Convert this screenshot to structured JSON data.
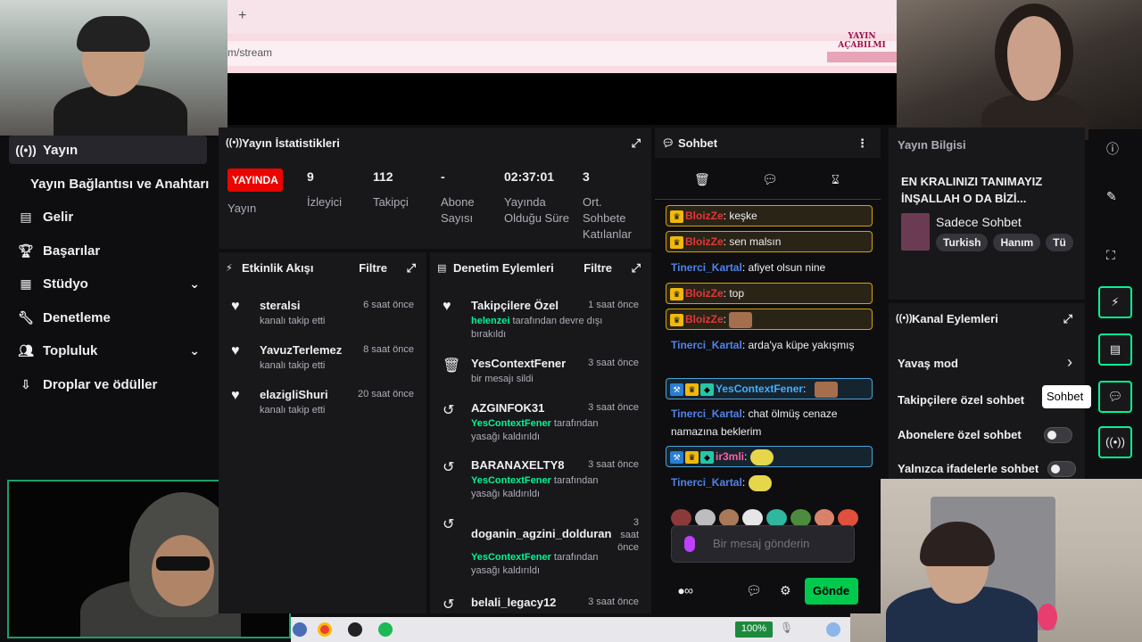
{
  "browser": {
    "url_partial": "m/stream",
    "new_tab": "+",
    "banner_text": "YAYIN AÇABILMI"
  },
  "nav": {
    "items": [
      {
        "label": "Yayın",
        "icon": "broadcast-icon"
      },
      {
        "label": "Yayın Bağlantısı ve Anahtarı",
        "icon": ""
      },
      {
        "label": "Gelir",
        "icon": "revenue-icon"
      },
      {
        "label": "Başarılar",
        "icon": "trophy-icon"
      },
      {
        "label": "Stüdyo",
        "icon": "studio-icon"
      },
      {
        "label": "Denetleme",
        "icon": "wrench-icon"
      },
      {
        "label": "Topluluk",
        "icon": "community-icon"
      },
      {
        "label": "Droplar ve ödüller",
        "icon": "drops-icon"
      }
    ]
  },
  "stats": {
    "title": "Yayın İstatistikleri",
    "live_badge": "YAYINDA",
    "cols": [
      {
        "value": "",
        "label": "Yayın"
      },
      {
        "value": "9",
        "label": "İzleyici"
      },
      {
        "value": "112",
        "label": "Takipçi"
      },
      {
        "value": "-",
        "label": "Abone Sayısı"
      },
      {
        "value": "02:37:01",
        "label": "Yayında Olduğu Süre"
      },
      {
        "value": "3",
        "label": "Ort. Sohbete Katılanlar"
      }
    ]
  },
  "activity": {
    "title": "Etkinlik Akışı",
    "filter": "Filtre",
    "items": [
      {
        "user": "steralsi",
        "time": "6 saat önce",
        "desc": "kanalı takip etti"
      },
      {
        "user": "YavuzTerlemez",
        "time": "8 saat önce",
        "desc": "kanalı takip etti"
      },
      {
        "user": "elazigliShuri",
        "time": "20 saat önce",
        "desc": "kanalı takip etti"
      }
    ]
  },
  "mod": {
    "title": "Denetim Eylemleri",
    "filter": "Filtre",
    "items": [
      {
        "title": "Takipçilere Özel",
        "time": "1 saat önce",
        "actor": "helenzei",
        "desc": " tarafından devre dışı bırakıldı"
      },
      {
        "title": "YesContextFener",
        "time": "3 saat önce",
        "actor": "",
        "desc": "bir mesajı sildi"
      },
      {
        "title": "AZGINFOK31",
        "time": "3 saat önce",
        "actor": "YesContextFener",
        "desc": " tarafından yasağı kaldırıldı"
      },
      {
        "title": "BARANAXELTY8",
        "time": "3 saat önce",
        "actor": "YesContextFener",
        "desc": " tarafından yasağı kaldırıldı"
      },
      {
        "title": "doganin_agzini_dolduran",
        "time": "3 saat önce",
        "actor": "YesContextFener",
        "desc": " tarafından yasağı kaldırıldı"
      },
      {
        "title": "belali_legacy12",
        "time": "3 saat önce",
        "actor": "",
        "desc": ""
      }
    ]
  },
  "chat": {
    "title": "Sohbet",
    "messages": [
      {
        "user": "BloizZe",
        "text": ": keşke"
      },
      {
        "user": "BloizZe",
        "text": ": sen malsın"
      },
      {
        "user": "Tinerci_Kartal",
        "text": ": afiyet olsun nine"
      },
      {
        "user": "BloizZe",
        "text": ": top"
      },
      {
        "user": "BloizZe",
        "text": ":"
      },
      {
        "user": "Tinerci_Kartal",
        "text": ": arda'ya küpe yakışmış"
      },
      {
        "user": "YesContextFener",
        "text": ":"
      },
      {
        "user": "Tinerci_Kartal",
        "text": ": chat ölmüş cenaze namazına beklerim"
      },
      {
        "user": "ir3mli",
        "text": ":"
      },
      {
        "user": "Tinerci_Kartal",
        "text": ":"
      }
    ],
    "input_placeholder": "Bir mesaj gönderin",
    "send_label": "Gönde"
  },
  "stream_info": {
    "header": "Yayın Bilgisi",
    "title": "EN KRALINIZI TANIMAYIZ İNŞALLAH O DA BİZİ...",
    "category": "Sadece Sohbet",
    "tags": [
      "Turkish",
      "Hanım",
      "Tü"
    ]
  },
  "channel_actions": {
    "title": "Kanal Eylemleri",
    "rows": [
      {
        "label": "Yavaş mod",
        "control": "chevron"
      },
      {
        "label": "Takipçilere özel sohbet",
        "control": "none"
      },
      {
        "label": "Abonelere özel sohbet",
        "control": "toggle"
      },
      {
        "label": "Yalnızca ifadelerle sohbet",
        "control": "toggle"
      }
    ]
  },
  "rail": {
    "tooltip": "Sohbet"
  },
  "taskbar": {
    "zoom": "100%"
  },
  "colors": {
    "accent_green": "#00f593",
    "live_red": "#eb0400",
    "panel": "#18181b",
    "bg": "#0e0e10"
  }
}
